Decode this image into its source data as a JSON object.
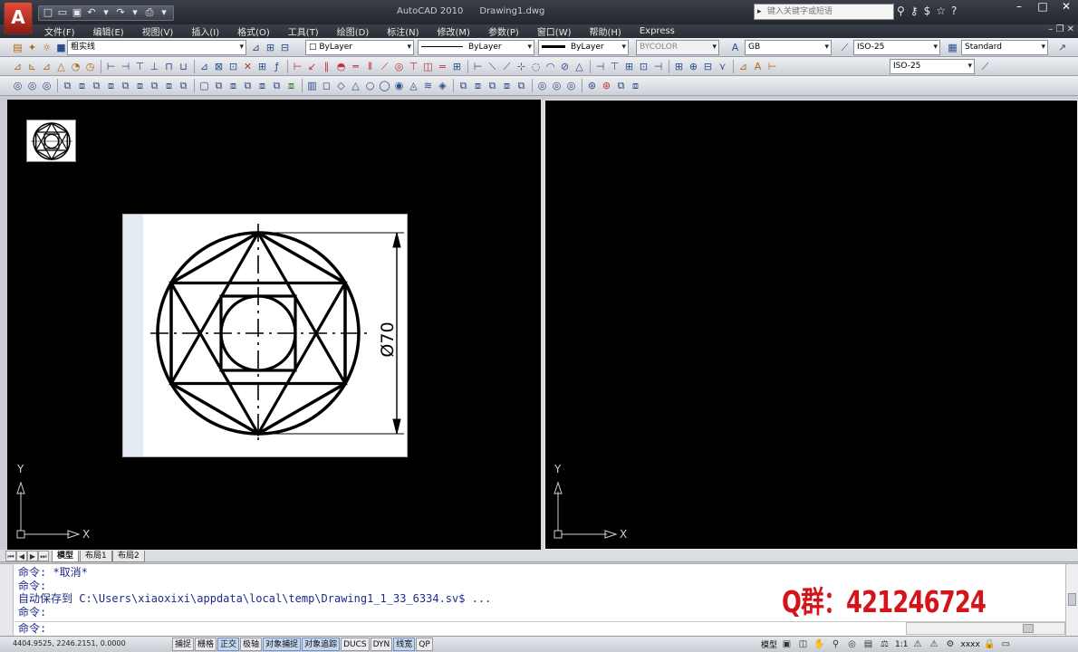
{
  "titlebar": {
    "app_name": "AutoCAD 2010",
    "document": "Drawing1.dwg",
    "search_placeholder": "键入关键字或短语",
    "app_button_label": "A"
  },
  "menu": [
    "文件(F)",
    "编辑(E)",
    "视图(V)",
    "插入(I)",
    "格式(O)",
    "工具(T)",
    "绘图(D)",
    "标注(N)",
    "修改(M)",
    "参数(P)",
    "窗口(W)",
    "帮助(H)",
    "Express"
  ],
  "properties": {
    "layer": "粗实线",
    "color": "ByLayer",
    "linetype": "ByLayer",
    "lineweight": "ByLayer",
    "plotstyle": "BYCOLOR",
    "text_style": "GB",
    "dim_style": "ISO-25",
    "table_style": "Standard",
    "multileader_style": "ISO-25"
  },
  "drawing": {
    "dimension_text": "Ø70"
  },
  "ucs": {
    "x_label": "X",
    "y_label": "Y"
  },
  "tabs": {
    "model": "模型",
    "layout1": "布局1",
    "layout2": "布局2"
  },
  "command_history": [
    "命令: *取消*",
    "命令:",
    "自动保存到 C:\\Users\\xiaoxixi\\appdata\\local\\temp\\Drawing1_1_33_6334.sv$ ...",
    "命令:"
  ],
  "command_prompt": "命令:",
  "watermark": "Q群：421246724",
  "status": {
    "coords": "4404.9525,  2246.2151,  0.0000",
    "toggles": [
      {
        "label": "捕捉",
        "on": false
      },
      {
        "label": "栅格",
        "on": false
      },
      {
        "label": "正交",
        "on": true
      },
      {
        "label": "极轴",
        "on": false
      },
      {
        "label": "对象捕捉",
        "on": true
      },
      {
        "label": "对象追踪",
        "on": true
      },
      {
        "label": "DUCS",
        "on": false
      },
      {
        "label": "DYN",
        "on": false
      },
      {
        "label": "线宽",
        "on": true
      },
      {
        "label": "QP",
        "on": false
      }
    ],
    "model_label": "模型",
    "scale": "1:1",
    "workspace": "xxxx"
  }
}
